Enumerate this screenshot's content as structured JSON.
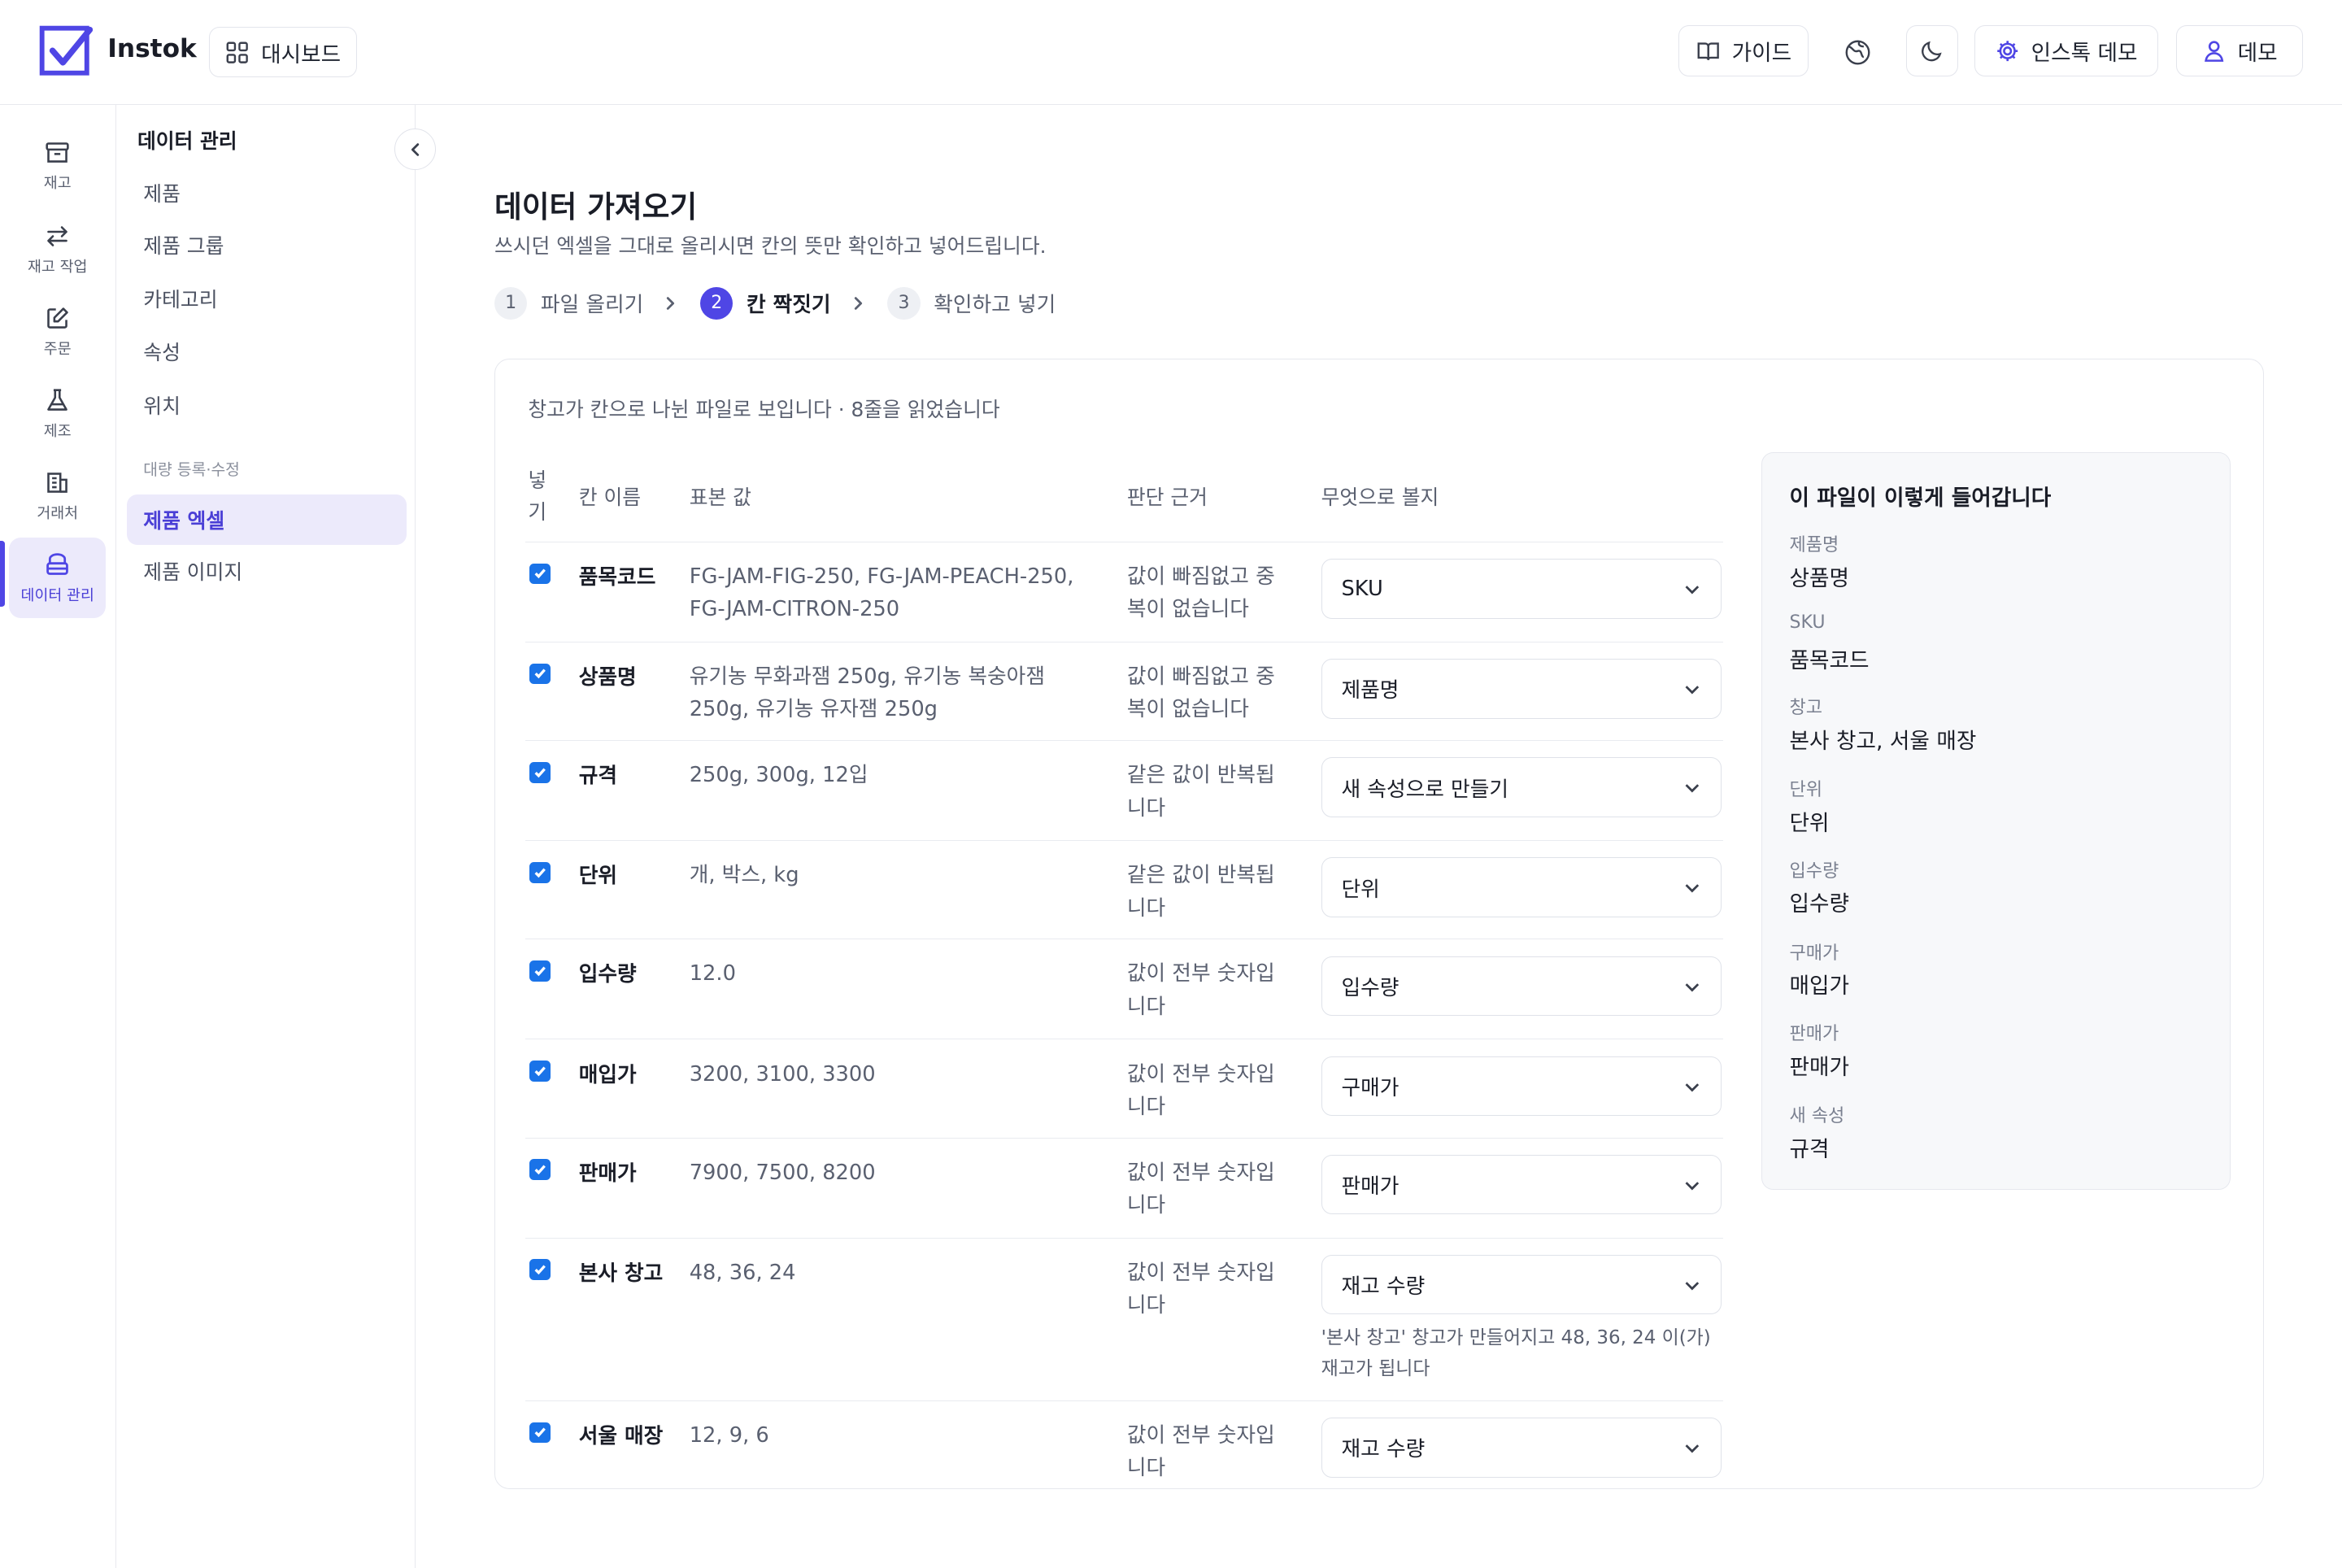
{
  "app": {
    "brand": "Instok",
    "dashboard_label": "대시보드",
    "guide_label": "가이드",
    "org_label": "인스톡 데모",
    "user_label": "데모"
  },
  "rail": [
    {
      "label": "재고",
      "icon": "archive-icon"
    },
    {
      "label": "재고 작업",
      "icon": "swap-arrows-icon"
    },
    {
      "label": "주문",
      "icon": "edit-order-icon"
    },
    {
      "label": "제조",
      "icon": "flask-icon"
    },
    {
      "label": "거래처",
      "icon": "building-icon"
    },
    {
      "label": "데이터 관리",
      "icon": "database-icon",
      "active": true
    }
  ],
  "subnav": {
    "title": "데이터 관리",
    "items": [
      "제품",
      "제품 그룹",
      "카테고리",
      "속성",
      "위치"
    ],
    "group_label": "대량 등록·수정",
    "group_items": [
      "제품 엑셀",
      "제품 이미지"
    ]
  },
  "page": {
    "title": "데이터 가져오기",
    "subtitle": "쓰시던 엑셀을 그대로 올리시면 칸의 뜻만 확인하고 넣어드립니다.",
    "steps": [
      {
        "num": "1",
        "label": "파일 올리기"
      },
      {
        "num": "2",
        "label": "칸 짝짓기",
        "active": true
      },
      {
        "num": "3",
        "label": "확인하고 넣기"
      }
    ],
    "note": "창고가 칸으로 나뉜 파일로 보입니다 · 8줄을 읽었습니다"
  },
  "table": {
    "headers": {
      "include_1": "넣",
      "include_2": "기",
      "name": "칸 이름",
      "sample": "표본 값",
      "reason": "판단 근거",
      "mapping": "무엇으로 볼지"
    },
    "rows": [
      {
        "name": "품목코드",
        "sample": "FG-JAM-FIG-250, FG-JAM-PEACH-250, FG-JAM-CITRON-250",
        "reason": "값이 빠짐없고 중복이 없습니다",
        "mapping": "SKU",
        "checked": true
      },
      {
        "name": "상품명",
        "sample": "유기농 무화과잼 250g, 유기농 복숭아잼 250g, 유기농 유자잼 250g",
        "reason": "값이 빠짐없고 중복이 없습니다",
        "mapping": "제품명",
        "checked": true
      },
      {
        "name": "규격",
        "sample": "250g, 300g, 12입",
        "reason": "같은 값이 반복됩니다",
        "mapping": "새 속성으로 만들기",
        "checked": true
      },
      {
        "name": "단위",
        "sample": "개, 박스, kg",
        "reason": "같은 값이 반복됩니다",
        "mapping": "단위",
        "checked": true
      },
      {
        "name": "입수량",
        "sample": "12.0",
        "reason": "값이 전부 숫자입니다",
        "mapping": "입수량",
        "checked": true
      },
      {
        "name": "매입가",
        "sample": "3200, 3100, 3300",
        "reason": "값이 전부 숫자입니다",
        "mapping": "구매가",
        "checked": true
      },
      {
        "name": "판매가",
        "sample": "7900, 7500, 8200",
        "reason": "값이 전부 숫자입니다",
        "mapping": "판매가",
        "checked": true
      },
      {
        "name": "본사 창고",
        "sample": "48, 36, 24",
        "reason": "값이 전부 숫자입니다",
        "mapping": "재고 수량",
        "hint": "'본사 창고' 창고가 만들어지고 48, 36, 24 이(가) 재고가 됩니다",
        "checked": true
      },
      {
        "name": "서울 매장",
        "sample": "12, 9, 6",
        "reason": "값이 전부 숫자입니다",
        "mapping": "재고 수량",
        "checked": true
      }
    ]
  },
  "summary": {
    "title": "이 파일이 이렇게 들어갑니다",
    "items": [
      {
        "label": "제품명",
        "value": "상품명"
      },
      {
        "label": "SKU",
        "value": "품목코드"
      },
      {
        "label": "창고",
        "value": "본사 창고, 서울 매장"
      },
      {
        "label": "단위",
        "value": "단위"
      },
      {
        "label": "입수량",
        "value": "입수량"
      },
      {
        "label": "구매가",
        "value": "매입가"
      },
      {
        "label": "판매가",
        "value": "판매가"
      },
      {
        "label": "새 속성",
        "value": "규격"
      }
    ]
  },
  "colors": {
    "accent": "#4f46e5",
    "active_bg": "#eceafb",
    "checkbox": "#1a73e8"
  }
}
